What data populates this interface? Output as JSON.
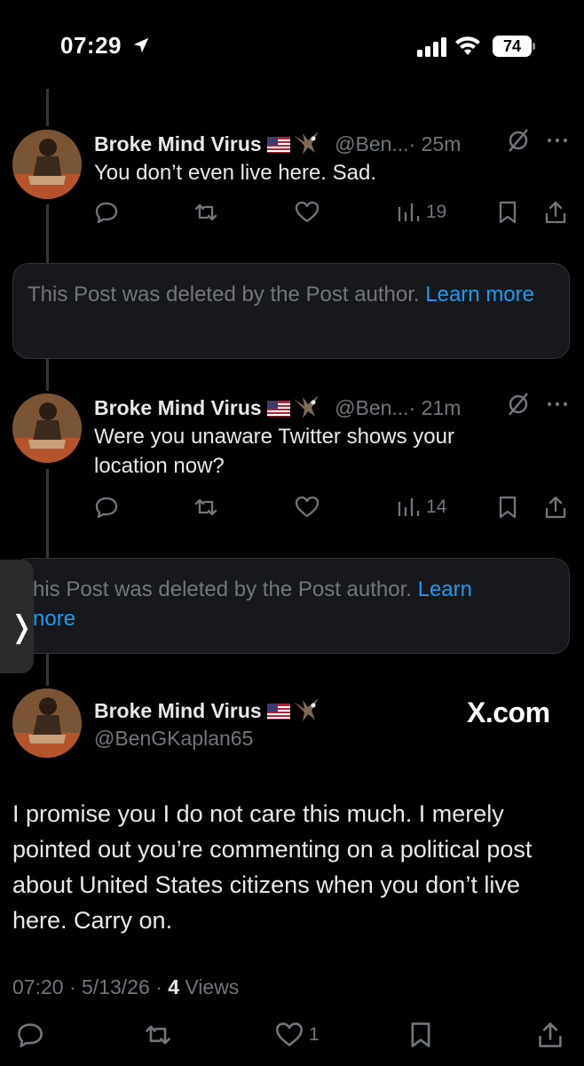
{
  "status_bar": {
    "time": "07:29",
    "battery": "74"
  },
  "replies": [
    {
      "name": "Broke Mind Virus",
      "handle": "@Ben...",
      "time": "· 25m",
      "text": "You don’t even live here. Sad.",
      "views": "19"
    },
    {
      "name": "Broke Mind Virus",
      "handle": "@Ben...",
      "time": "· 21m",
      "text": "Were you unaware Twitter shows your location now?",
      "views": "14"
    }
  ],
  "deleted_notice": {
    "text": "This Post was deleted by the Post author.",
    "link": "Learn more"
  },
  "deleted_notice_2": {
    "text": "his Post was deleted by the Post author.",
    "link": "Learn",
    "link2": "nore"
  },
  "main_post": {
    "name": "Broke Mind Virus",
    "handle": "@BenGKaplan65",
    "watermark": "X.com",
    "text": "I promise you I do not care this much. I merely pointed out you’re commenting on a political post about United States citizens when you don’t live here. Carry on.",
    "timestamp": "07:20 · 5/13/26 ·",
    "views_count": "4",
    "views_label": "Views",
    "likes": "1"
  },
  "icons": {
    "reply": "reply-icon",
    "repost": "repost-icon",
    "like": "heart-icon",
    "views": "views-icon",
    "bookmark": "bookmark-icon",
    "share": "share-icon",
    "mute": "mute-icon",
    "more": "more-icon"
  },
  "colors": {
    "background": "#000000",
    "text": "#e7e9ea",
    "muted": "#71767b",
    "link": "#1d9bf0"
  }
}
